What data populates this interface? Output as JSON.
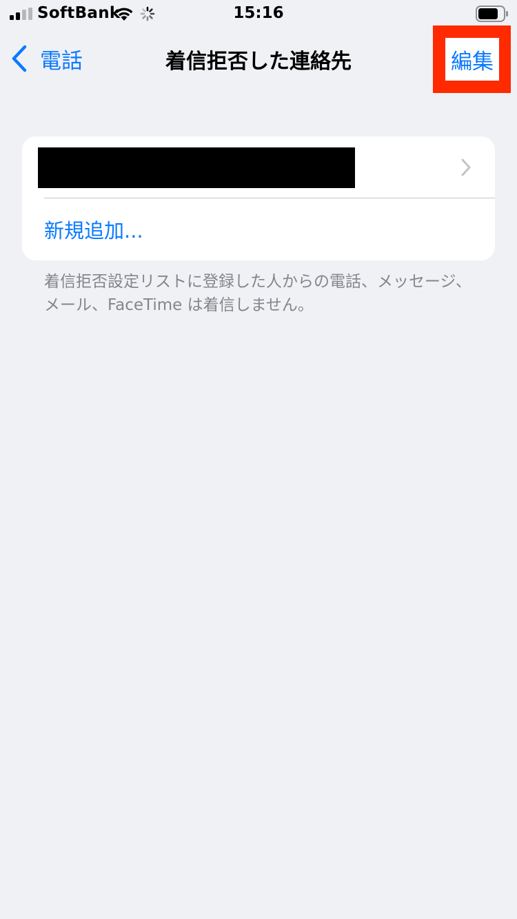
{
  "status_bar": {
    "carrier": "SoftBank",
    "time": "15:16",
    "icons": [
      "signal-icon",
      "wifi-icon",
      "activity-spinner-icon",
      "battery-icon"
    ]
  },
  "nav": {
    "back_label": "電話",
    "title": "着信拒否した連絡先",
    "edit_label": "編集"
  },
  "list": {
    "blocked_contact": {
      "name_redacted": true
    },
    "add_new_label": "新規追加..."
  },
  "footer": {
    "note": "着信拒否設定リストに登録した人からの電話、メッセージ、メール、FaceTime は着信しません。"
  },
  "colors": {
    "accent": "#0a7aff",
    "background": "#f0f1f5",
    "card": "#ffffff",
    "highlight": "#ff2a00",
    "secondary_text": "#85858b"
  }
}
